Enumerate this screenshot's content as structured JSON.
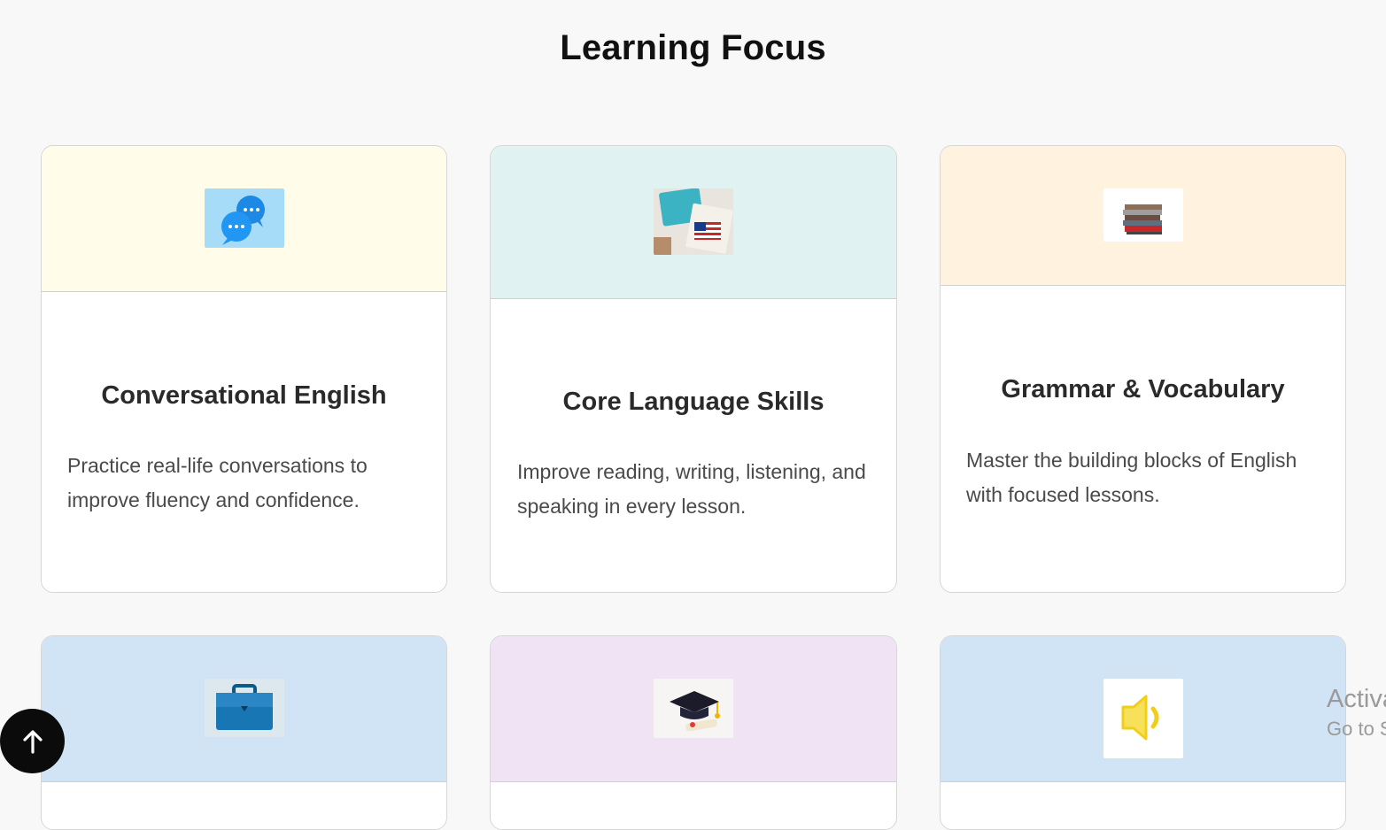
{
  "section": {
    "title": "Learning Focus"
  },
  "cards": [
    {
      "title": "Conversational English",
      "description": "Practice real-life conversations to improve fluency and confidence.",
      "header_color": "#fffce9",
      "icon": "chat-bubbles-icon"
    },
    {
      "title": "Core Language Skills",
      "description": "Improve reading, writing, listening, and speaking in every lesson.",
      "header_color": "#e0f2f1",
      "icon": "english-books-photo"
    },
    {
      "title": "Grammar & Vocabulary",
      "description": "Master the building blocks of English with focused lessons.",
      "header_color": "#fff3e0",
      "icon": "book-stack-icon"
    },
    {
      "title": "",
      "description": "",
      "header_color": "#d1e4f6",
      "icon": "briefcase-icon"
    },
    {
      "title": "",
      "description": "",
      "header_color": "#f0e4f4",
      "icon": "graduation-cap-icon"
    },
    {
      "title": "",
      "description": "",
      "header_color": "#d1e4f6",
      "icon": "speaker-icon"
    }
  ],
  "back_to_top": {
    "icon": "arrow-up-icon"
  },
  "watermark": {
    "line1": "Activa",
    "line2": "Go to S"
  }
}
